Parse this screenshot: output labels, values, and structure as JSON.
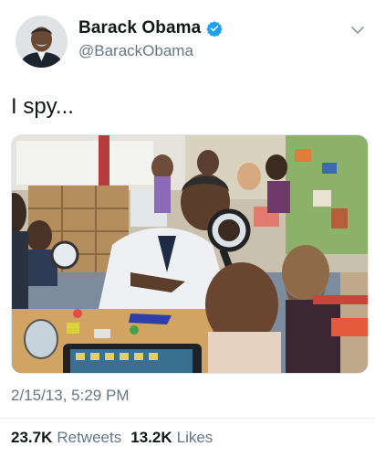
{
  "author": {
    "display_name": "Barack Obama",
    "handle": "@BarackObama",
    "verified": true
  },
  "icons": {
    "verified": "verified-badge-icon",
    "menu": "chevron-down-icon"
  },
  "tweet": {
    "text": "I spy...",
    "timestamp": "2/15/13, 5:29 PM"
  },
  "stats": {
    "retweets_count": "23.7K",
    "retweets_label": "Retweets",
    "likes_count": "13.2K",
    "likes_label": "Likes"
  },
  "colors": {
    "verified_blue": "#1da1f2",
    "secondary_text": "#657786"
  }
}
